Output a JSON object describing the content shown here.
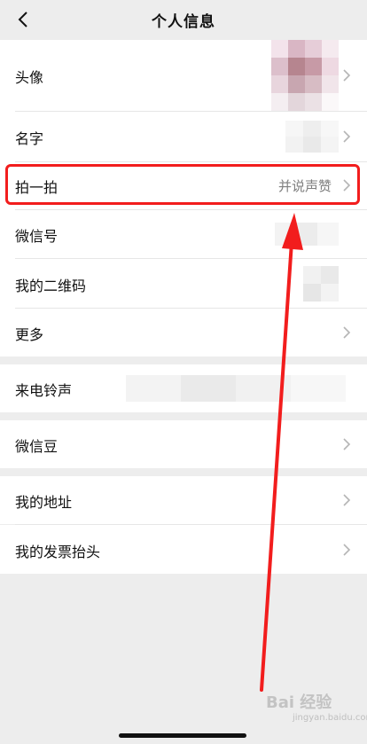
{
  "header": {
    "title": "个人信息"
  },
  "section1": {
    "rows": [
      {
        "label": "头像"
      },
      {
        "label": "名字"
      },
      {
        "label": "拍一拍",
        "value": "并说声赞"
      },
      {
        "label": "微信号"
      },
      {
        "label": "我的二维码"
      },
      {
        "label": "更多"
      }
    ]
  },
  "section2": {
    "rows": [
      {
        "label": "来电铃声"
      }
    ]
  },
  "section3": {
    "rows": [
      {
        "label": "微信豆"
      }
    ]
  },
  "section4": {
    "rows": [
      {
        "label": "我的地址"
      },
      {
        "label": "我的发票抬头"
      }
    ]
  },
  "watermark": {
    "text": "Bai 经验",
    "sub": "jingyan.baidu.com"
  },
  "colors": {
    "highlight": "#f21d1d",
    "arrow": "#f21d1d",
    "page_bg": "#ededed"
  }
}
